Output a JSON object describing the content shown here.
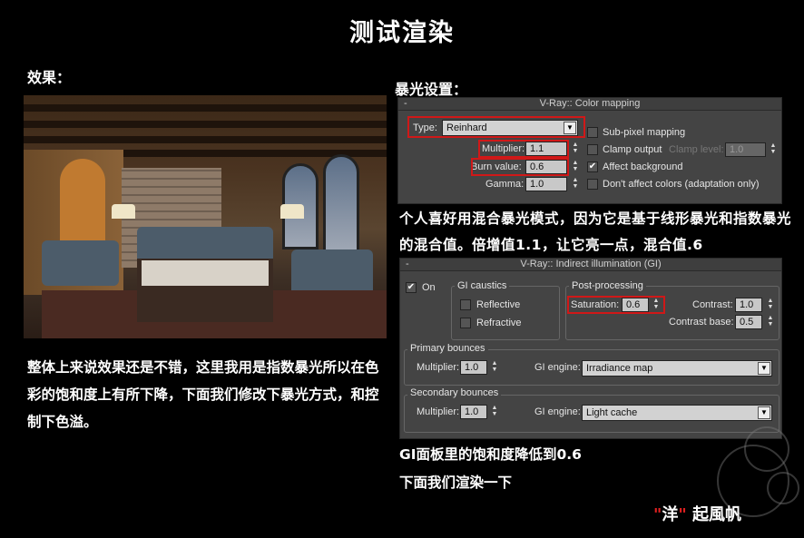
{
  "title": "测试渲染",
  "labels": {
    "effect": "效果：",
    "exposure": "暴光设置："
  },
  "paragraphs": {
    "p1": "整体上来说效果还是不错，这里我用是指数暴光所以在色彩的饱和度上有所下降，下面我们修改下暴光方式，和控制下色溢。",
    "p2": "个人喜好用混合暴光模式，因为它是基于线形暴光和指数暴光的混合值。倍增值1.1，让它亮一点，混合值.6",
    "p3a": "GI面板里的饱和度降低到0.6",
    "p3b": "下面我们渲染一下"
  },
  "signature": {
    "q1": "\"",
    "name": "洋",
    "q2": "\"",
    "rest": " 起風帆"
  },
  "color_mapping": {
    "header": "V-Ray:: Color mapping",
    "minus": "-",
    "type_label": "Type:",
    "type_value": "Reinhard",
    "multiplier_label": "Multiplier:",
    "multiplier_value": "1.1",
    "burn_label": "Burn value:",
    "burn_value": "0.6",
    "gamma_label": "Gamma:",
    "gamma_value": "1.0",
    "subpixel": "Sub-pixel mapping",
    "clamp_output": "Clamp output",
    "clamp_level_label": "Clamp level:",
    "clamp_level_value": "1.0",
    "affect_bg": "Affect background",
    "dont_affect": "Don't affect colors (adaptation only)"
  },
  "gi": {
    "header": "V-Ray:: Indirect illumination (GI)",
    "minus": "-",
    "on_label": "On",
    "caustics_title": "GI caustics",
    "reflective": "Reflective",
    "refractive": "Refractive",
    "post_title": "Post-processing",
    "saturation_label": "Saturation:",
    "saturation_value": "0.6",
    "contrast_label": "Contrast:",
    "contrast_value": "1.0",
    "contrast_base_label": "Contrast base:",
    "contrast_base_value": "0.5",
    "primary_title": "Primary bounces",
    "primary_mult_label": "Multiplier:",
    "primary_mult_value": "1.0",
    "primary_engine_label": "GI engine:",
    "primary_engine_value": "Irradiance map",
    "secondary_title": "Secondary bounces",
    "secondary_mult_label": "Multiplier:",
    "secondary_mult_value": "1.0",
    "secondary_engine_label": "GI engine:",
    "secondary_engine_value": "Light cache"
  },
  "icons": {
    "check": "✔",
    "arrow_down": "▼",
    "arrow_up": "▲"
  }
}
